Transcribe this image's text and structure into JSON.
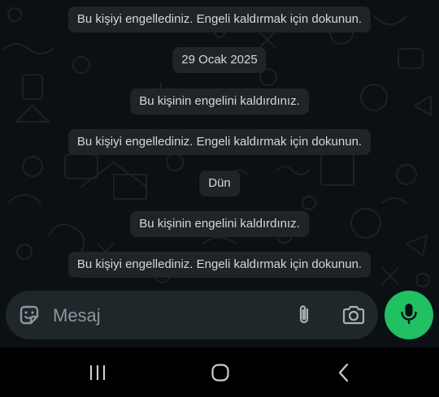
{
  "messages": [
    {
      "type": "system",
      "text": "Bu kişiyi engellediniz. Engeli kaldırmak için dokunun."
    },
    {
      "type": "date",
      "text": "29 Ocak 2025"
    },
    {
      "type": "system",
      "text": "Bu kişinin engelini kaldırdınız."
    },
    {
      "type": "system",
      "text": "Bu kişiyi engellediniz. Engeli kaldırmak için dokunun."
    },
    {
      "type": "date",
      "text": "Dün"
    },
    {
      "type": "system",
      "text": "Bu kişinin engelini kaldırdınız."
    },
    {
      "type": "system",
      "text": "Bu kişiyi engellediniz. Engeli kaldırmak için dokunun."
    }
  ],
  "composer": {
    "placeholder": "Mesaj",
    "emoji_icon": "sticker-emoji-icon",
    "attach_icon": "paperclip-icon",
    "camera_icon": "camera-icon",
    "mic_icon": "microphone-icon"
  },
  "navbar": {
    "recents_icon": "recent-apps-icon",
    "home_icon": "home-icon",
    "back_icon": "back-icon"
  },
  "colors": {
    "chat_background": "#0b1014",
    "system_bubble": "#1e2428",
    "system_text": "#d4d8da",
    "input_bar": "#1f272b",
    "mic_button": "#21c063",
    "navbar": "#000000"
  }
}
